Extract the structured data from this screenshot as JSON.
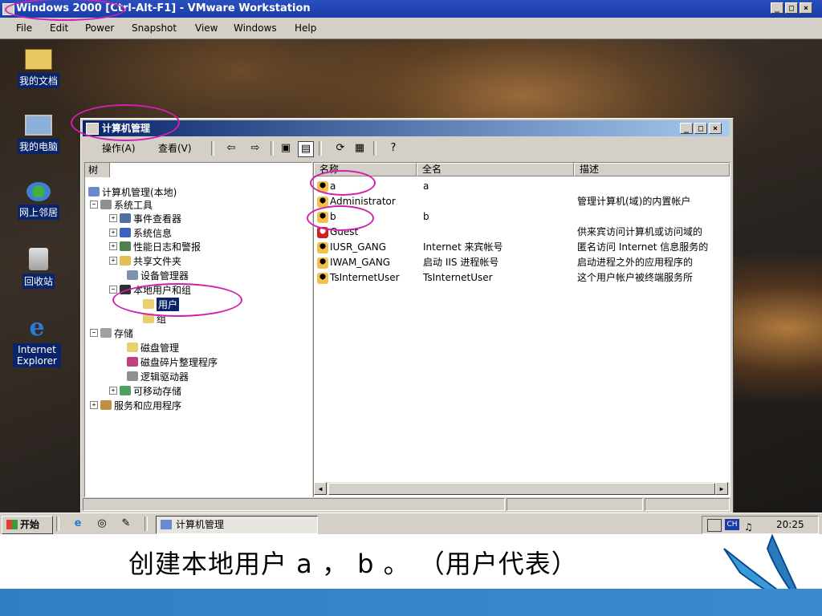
{
  "vm": {
    "title": "Windows 2000 [Ctrl-Alt-F1] - VMware Workstation",
    "menu": [
      "File",
      "Edit",
      "Power",
      "Snapshot",
      "View",
      "Windows",
      "Help"
    ],
    "win_buttons": [
      "_",
      "□",
      "×"
    ]
  },
  "desktop_icons": [
    {
      "label": "我的文档",
      "icon": "folder-documents-icon"
    },
    {
      "label": "我的电脑",
      "icon": "computer-icon"
    },
    {
      "label": "网上邻居",
      "icon": "network-icon"
    },
    {
      "label": "回收站",
      "icon": "recycle-bin-icon"
    },
    {
      "label": "Internet Explorer",
      "icon": "internet-explorer-icon"
    }
  ],
  "app": {
    "title": "计算机管理",
    "action_menu": "操作(A)",
    "view_menu": "查看(V)",
    "tree_header": "树",
    "tree": [
      "计算机管理(本地)",
      "系统工具",
      "事件查看器",
      "系统信息",
      "性能日志和警报",
      "共享文件夹",
      "设备管理器",
      "本地用户和组",
      "用户",
      "组",
      "存储",
      "磁盘管理",
      "磁盘碎片整理程序",
      "逻辑驱动器",
      "可移动存储",
      "服务和应用程序"
    ],
    "columns": [
      "名称",
      "全名",
      "描述"
    ],
    "users": [
      {
        "name": "a",
        "fullname": "a",
        "desc": ""
      },
      {
        "name": "Administrator",
        "fullname": "",
        "desc": "管理计算机(域)的内置帐户"
      },
      {
        "name": "b",
        "fullname": "b",
        "desc": ""
      },
      {
        "name": "Guest",
        "fullname": "",
        "desc": "供来宾访问计算机或访问域的"
      },
      {
        "name": "IUSR_GANG",
        "fullname": "Internet 来宾帐号",
        "desc": "匿名访问 Internet 信息服务的"
      },
      {
        "name": "IWAM_GANG",
        "fullname": "启动 IIS 进程帐号",
        "desc": "启动进程之外的应用程序的"
      },
      {
        "name": "TsInternetUser",
        "fullname": "TsInternetUser",
        "desc": "这个用户帐户被终端服务所"
      }
    ]
  },
  "taskbar": {
    "start": "开始",
    "task": "计算机管理",
    "lang": "CH",
    "time": "20:25"
  },
  "caption": "创建本地用户 a ， b 。 （用户代表）",
  "colors": {
    "title_blue": "#0a246a",
    "highlight": "#d020b0",
    "band": "#2f7fc4"
  }
}
